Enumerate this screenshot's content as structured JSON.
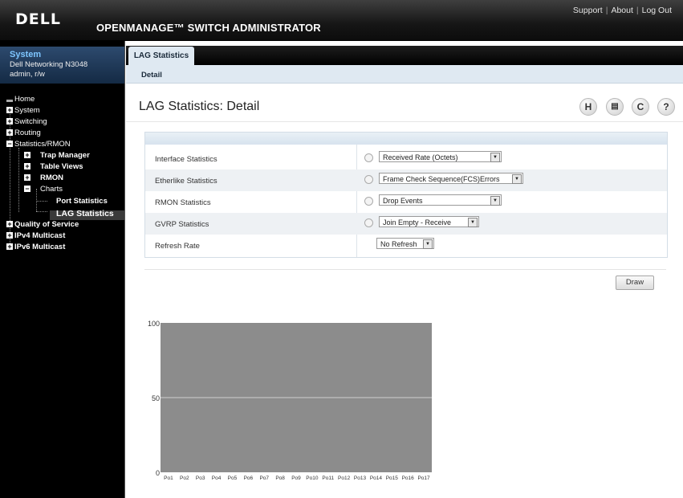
{
  "header": {
    "logo": "DELL",
    "product": "OPENMANAGE™ SWITCH ADMINISTRATOR",
    "links": [
      "Support",
      "About",
      "Log Out"
    ]
  },
  "system": {
    "title": "System",
    "model": "Dell Networking N3048",
    "user": "admin, r/w"
  },
  "nav": {
    "home": "Home",
    "system": "System",
    "switching": "Switching",
    "routing": "Routing",
    "stats": "Statistics/RMON",
    "trap": "Trap Manager",
    "table_views": "Table Views",
    "rmon": "RMON",
    "charts": "Charts",
    "port_stats": "Port Statistics",
    "lag_stats": "LAG Statistics",
    "qos": "Quality of Service",
    "ipv4mc": "IPv4 Multicast",
    "ipv6mc": "IPv6 Multicast"
  },
  "tabs": {
    "main": "LAG Statistics",
    "sub": "Detail"
  },
  "page_title": "LAG Statistics: Detail",
  "toolbar_icons": [
    "help-manual-icon",
    "print-icon",
    "refresh-icon",
    "help-icon"
  ],
  "form": {
    "rows": [
      {
        "label": "Interface Statistics",
        "value": "Received Rate (Octets)"
      },
      {
        "label": "Etherlike Statistics",
        "value": "Frame Check Sequence(FCS)Errors"
      },
      {
        "label": "RMON Statistics",
        "value": "Drop Events"
      },
      {
        "label": "GVRP Statistics",
        "value": "Join Empty - Receive"
      },
      {
        "label": "Refresh Rate",
        "value": "No Refresh"
      }
    ]
  },
  "draw_label": "Draw",
  "chart_data": {
    "type": "bar",
    "categories": [
      "Po1",
      "Po2",
      "Po3",
      "Po4",
      "Po5",
      "Po6",
      "Po7",
      "Po8",
      "Po9",
      "Po10",
      "Po11",
      "Po12",
      "Po13",
      "Po14",
      "Po15",
      "Po16",
      "Po17"
    ],
    "values": [
      0,
      0,
      0,
      0,
      0,
      0,
      0,
      0,
      0,
      0,
      0,
      0,
      0,
      0,
      0,
      0,
      0
    ],
    "ylim": [
      0,
      100
    ],
    "yticks": [
      0,
      50,
      100
    ],
    "grid": true,
    "colors": {
      "plot_bg": "#8c8c8c",
      "grid": "#cfcfcf"
    }
  }
}
